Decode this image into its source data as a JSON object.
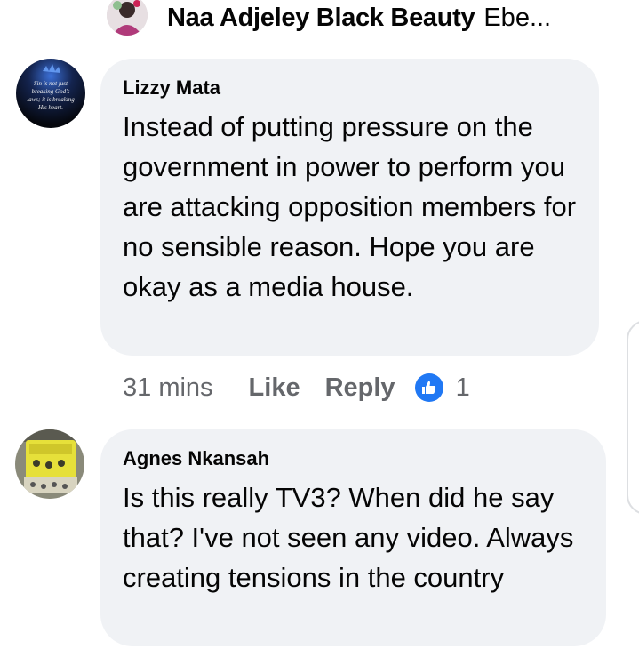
{
  "parent_reply": {
    "name": "Naa Adjeley Black Beauty",
    "snippet": "Ebe...",
    "avatar_icon": "profile-photo-icon"
  },
  "comments": [
    {
      "author": "Lizzy Mata",
      "avatar_lines": [
        "Sin is not just",
        "breaking God's",
        "laws; it is breaking",
        "His heart."
      ],
      "text": "Instead of putting pressure on the government in power to perform you are attacking opposition members for no sensible reason. Hope you are okay as a media house.",
      "time": "31 mins",
      "like_label": "Like",
      "reply_label": "Reply",
      "reaction_count": "1",
      "reaction_icon": "like-thumb-icon"
    },
    {
      "author": "Agnes Nkansah",
      "text": "Is this really TV3? When did he say that? I've not seen any video. Always creating tensions in the country",
      "avatar_icon": "fabric-photo-icon"
    }
  ],
  "colors": {
    "bubble": "#f0f2f5",
    "meta_text": "#65676b",
    "like_blue": "#2078f4"
  }
}
